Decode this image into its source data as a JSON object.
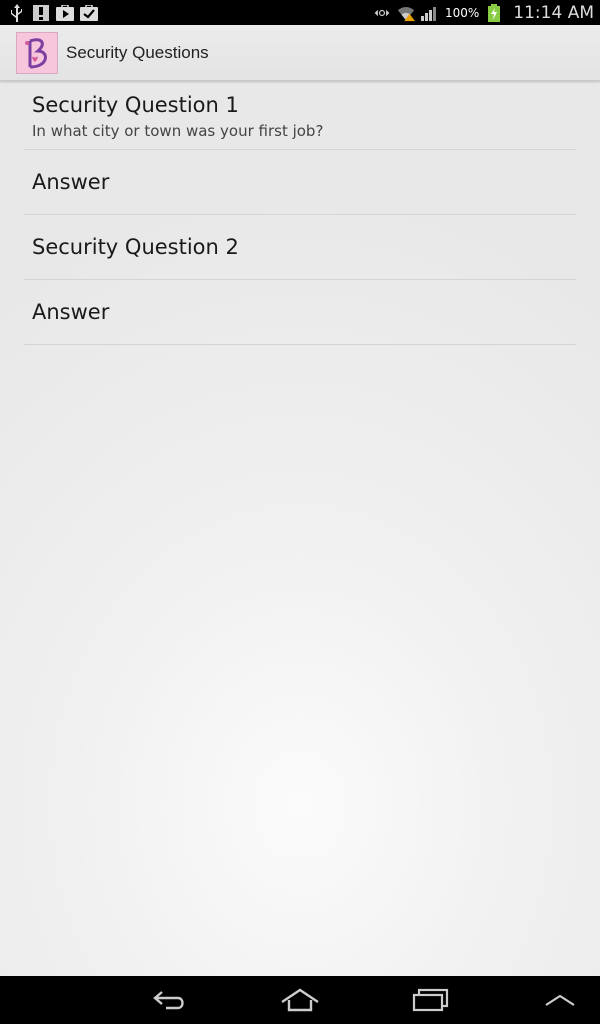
{
  "status_bar": {
    "left_icons": [
      "usb-icon",
      "warning-icon",
      "play-store-icon",
      "clipboard-check-icon"
    ],
    "right_icons": [
      "data-sync-icon",
      "wifi-icon",
      "signal-icon",
      "battery-charging-icon"
    ],
    "battery_percent": "100%",
    "time": "11:14 AM"
  },
  "action_bar": {
    "icon": "app-logo-icon",
    "title": "Security Questions"
  },
  "preferences": [
    {
      "title": "Security Question 1",
      "summary": "In what city or town was your first job?"
    },
    {
      "title": "Answer"
    },
    {
      "title": "Security Question 2"
    },
    {
      "title": "Answer"
    }
  ],
  "nav_bar": {
    "buttons": [
      "back-icon",
      "home-icon",
      "recent-apps-icon",
      "menu-up-icon"
    ]
  },
  "colors": {
    "status_bg": "#000000",
    "action_bar_bg": "#e8e8e8",
    "app_icon_bg": "#f6c6dc",
    "logo_purple": "#7b3fa0"
  }
}
